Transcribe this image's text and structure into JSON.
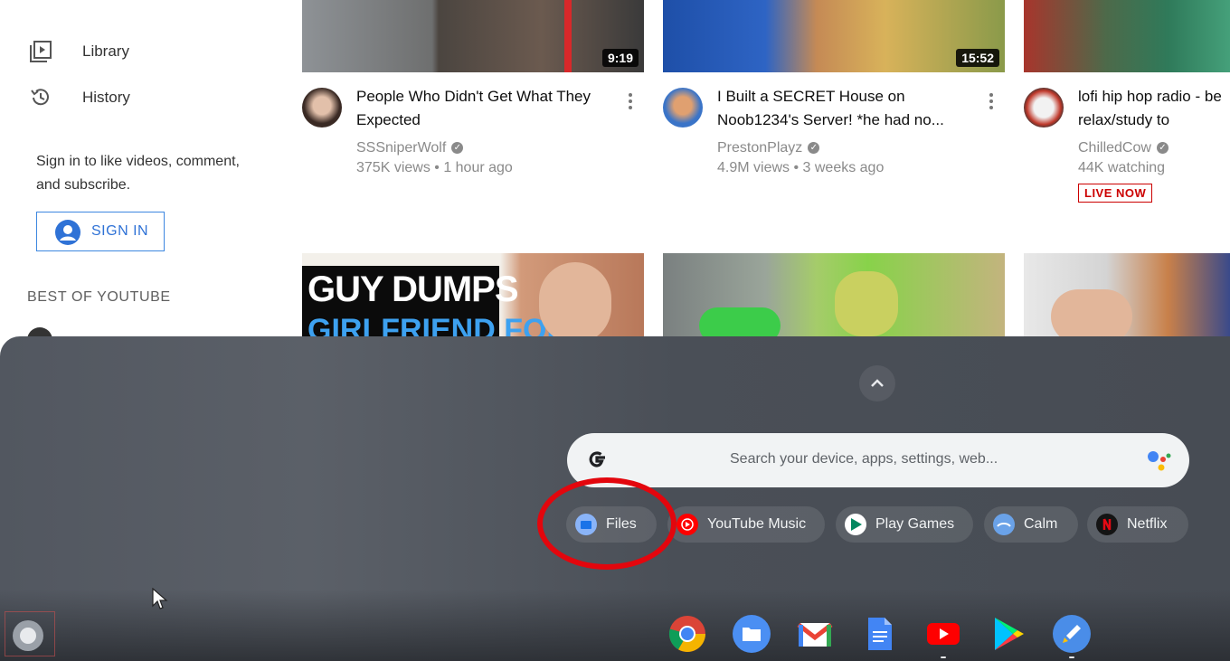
{
  "sidebar": {
    "items": [
      {
        "label": "Library",
        "icon": "library-icon"
      },
      {
        "label": "History",
        "icon": "history-icon"
      }
    ],
    "signin_prompt": "Sign in to like videos, comment, and subscribe.",
    "signin_button": "SIGN IN",
    "best_of_header": "BEST OF YOUTUBE"
  },
  "videos": [
    {
      "title_line1": "People Who Didn't Get What They",
      "title_line2": "Expected",
      "channel": "SSSniperWolf",
      "meta": "375K views • 1 hour ago",
      "duration": "9:19"
    },
    {
      "title_line1": "I Built a SECRET House on",
      "title_line2": "Noob1234's Server! *he had no...",
      "channel": "PrestonPlayz",
      "meta": "4.9M views • 3 weeks ago",
      "duration": "15:52"
    },
    {
      "title_line1": "lofi hip hop radio - be",
      "title_line2": "relax/study to",
      "channel": "ChilledCow",
      "meta": "44K watching",
      "live_label": "LIVE NOW"
    }
  ],
  "second_row": {
    "thumb1_text_line1": "GUY DUMPS",
    "thumb1_text_line2": "GIRLFRIEND FOR"
  },
  "launcher": {
    "search_placeholder": "Search your device, apps, settings, web...",
    "chips": [
      {
        "label": "Files",
        "icon": "files-icon",
        "color": "#8ab4f8"
      },
      {
        "label": "YouTube Music",
        "icon": "youtube-music-icon",
        "color": "#ff0000"
      },
      {
        "label": "Play Games",
        "icon": "play-games-icon",
        "color": "#01875f"
      },
      {
        "label": "Calm",
        "icon": "calm-icon",
        "color": "#6aa2e8"
      },
      {
        "label": "Netflix",
        "icon": "netflix-icon",
        "color": "#e50914"
      }
    ]
  },
  "shelf": {
    "apps": [
      "chrome-icon",
      "files-icon",
      "gmail-icon",
      "docs-icon",
      "youtube-icon",
      "play-store-icon",
      "app-icon"
    ]
  },
  "colors": {
    "accent_blue": "#3d87e0",
    "annotation_red": "#e3060d",
    "launcher_bg": "#50555d"
  }
}
